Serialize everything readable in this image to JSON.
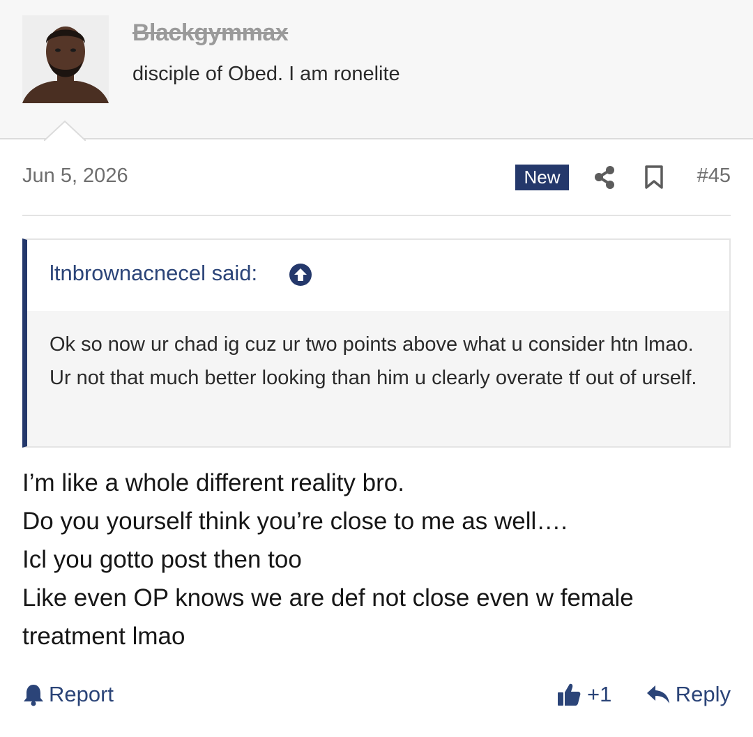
{
  "user": {
    "username": "Blackgymmax",
    "title": "disciple of Obed. I am ronelite",
    "avatar_icon": "avatar-photo"
  },
  "post": {
    "date": "Jun 5, 2026",
    "badge": "New",
    "number": "#45",
    "share_icon": "share-icon",
    "bookmark_icon": "bookmark-icon"
  },
  "quote": {
    "author": "ltnbrownacnecel said:",
    "text": "Ok so now ur chad ig cuz ur two points above what u consider htn lmao. Ur not that much better looking than him u clearly overate tf out of urself."
  },
  "message": {
    "lines": [
      "I’m like a whole different reality bro.",
      "Do you yourself think you’re close to me as well….",
      "Icl you gotto post then too",
      "Like even OP knows we are def not close even w female",
      "treatment lmao"
    ]
  },
  "footer": {
    "report": "Report",
    "like_count": "+1",
    "reply": "Reply"
  },
  "colors": {
    "accent": "#24386b",
    "link": "#2b4478"
  }
}
